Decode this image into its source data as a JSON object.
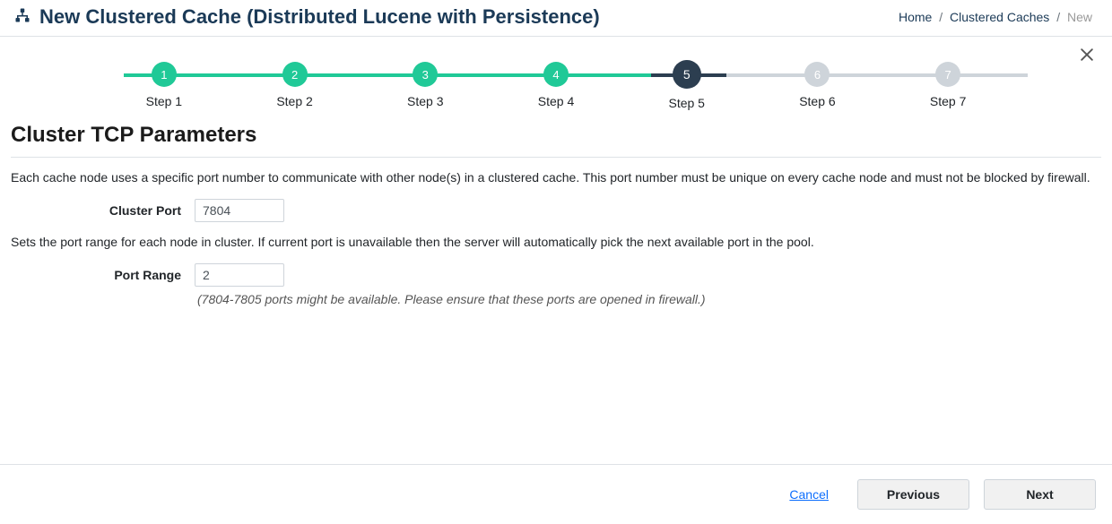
{
  "header": {
    "title": "New Clustered Cache (Distributed Lucene with Persistence)"
  },
  "breadcrumb": {
    "home": "Home",
    "parent": "Clustered Caches",
    "current": "New"
  },
  "stepper": {
    "steps": [
      {
        "num": "1",
        "label": "Step 1"
      },
      {
        "num": "2",
        "label": "Step 2"
      },
      {
        "num": "3",
        "label": "Step 3"
      },
      {
        "num": "4",
        "label": "Step 4"
      },
      {
        "num": "5",
        "label": "Step 5"
      },
      {
        "num": "6",
        "label": "Step 6"
      },
      {
        "num": "7",
        "label": "Step 7"
      }
    ]
  },
  "section": {
    "title": "Cluster TCP Parameters",
    "clusterPortDesc": "Each cache node uses a specific port number to communicate with other node(s) in a clustered cache. This port number must be unique on every cache node and must not be blocked by firewall.",
    "clusterPortLabel": "Cluster Port",
    "clusterPortValue": "7804",
    "portRangeDesc": "Sets the port range for each node in cluster. If current port is unavailable then the server will automatically pick the next available port in the pool.",
    "portRangeLabel": "Port Range",
    "portRangeValue": "2",
    "portRangeHint": "(7804-7805 ports might be available. Please ensure that these ports are opened in firewall.)"
  },
  "footer": {
    "cancel": "Cancel",
    "previous": "Previous",
    "next": "Next"
  }
}
